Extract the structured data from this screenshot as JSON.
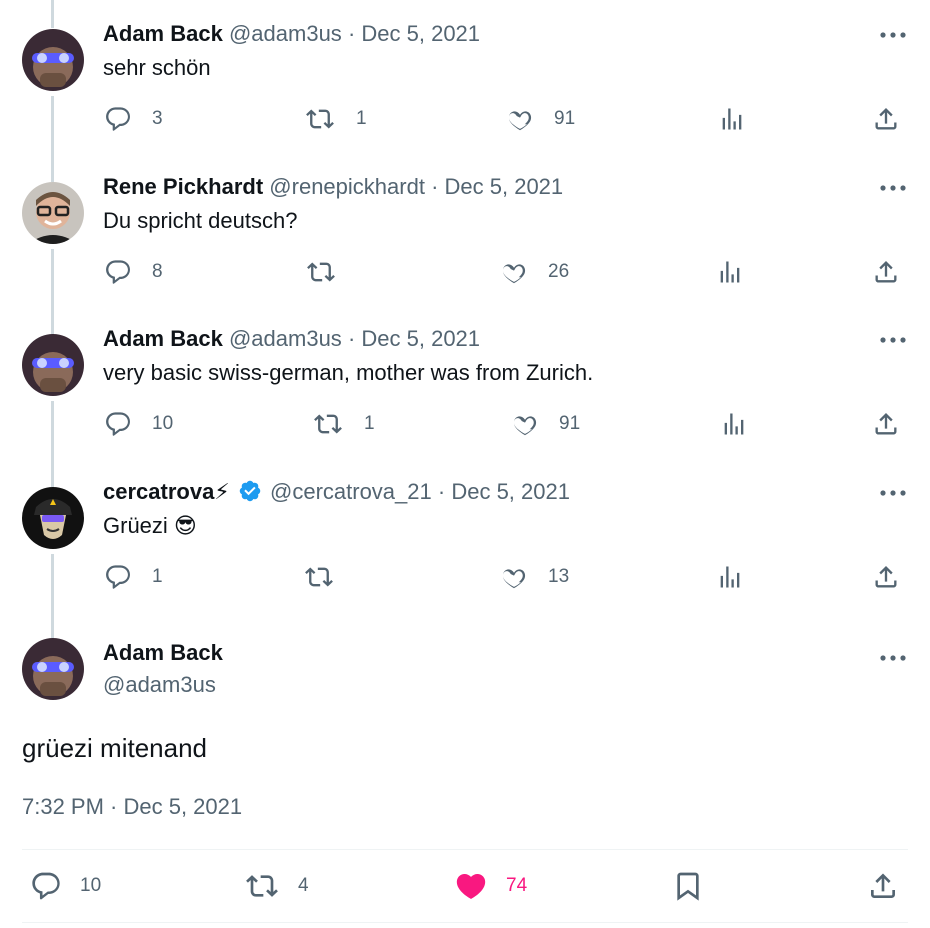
{
  "tweets": [
    {
      "name": "Adam Back",
      "handle": "@adam3us",
      "date": "Dec 5, 2021",
      "text": "sehr schön",
      "replies": "3",
      "retweets": "1",
      "likes": "91"
    },
    {
      "name": "Rene Pickhardt",
      "handle": "@renepickhardt",
      "date": "Dec 5, 2021",
      "text": "Du spricht deutsch?",
      "replies": "8",
      "retweets": "",
      "likes": "26"
    },
    {
      "name": "Adam Back",
      "handle": "@adam3us",
      "date": "Dec 5, 2021",
      "text": "very basic swiss-german, mother was from Zurich.",
      "replies": "10",
      "retweets": "1",
      "likes": "91"
    },
    {
      "name": "cercatrova⚡",
      "handle": "@cercatrova_21",
      "date": "Dec 5, 2021",
      "text": "Grüezi",
      "emoji": "😎",
      "verified": true,
      "replies": "1",
      "retweets": "",
      "likes": "13"
    }
  ],
  "main_tweet": {
    "name": "Adam Back",
    "handle": "@adam3us",
    "text": "grüezi mitenand",
    "timestamp": "7:32 PM · Dec 5, 2021",
    "replies": "10",
    "retweets": "4",
    "likes": "74",
    "liked": true
  },
  "separator": "·",
  "colors": {
    "text": "#0f1419",
    "secondary": "#536471",
    "like": "#f91880",
    "verified": "#1d9bf0",
    "thread_line": "#cfd9de"
  },
  "icons": [
    "reply-icon",
    "retweet-icon",
    "like-icon",
    "views-icon",
    "share-icon",
    "bookmark-icon",
    "more-icon",
    "verified-badge-icon"
  ]
}
